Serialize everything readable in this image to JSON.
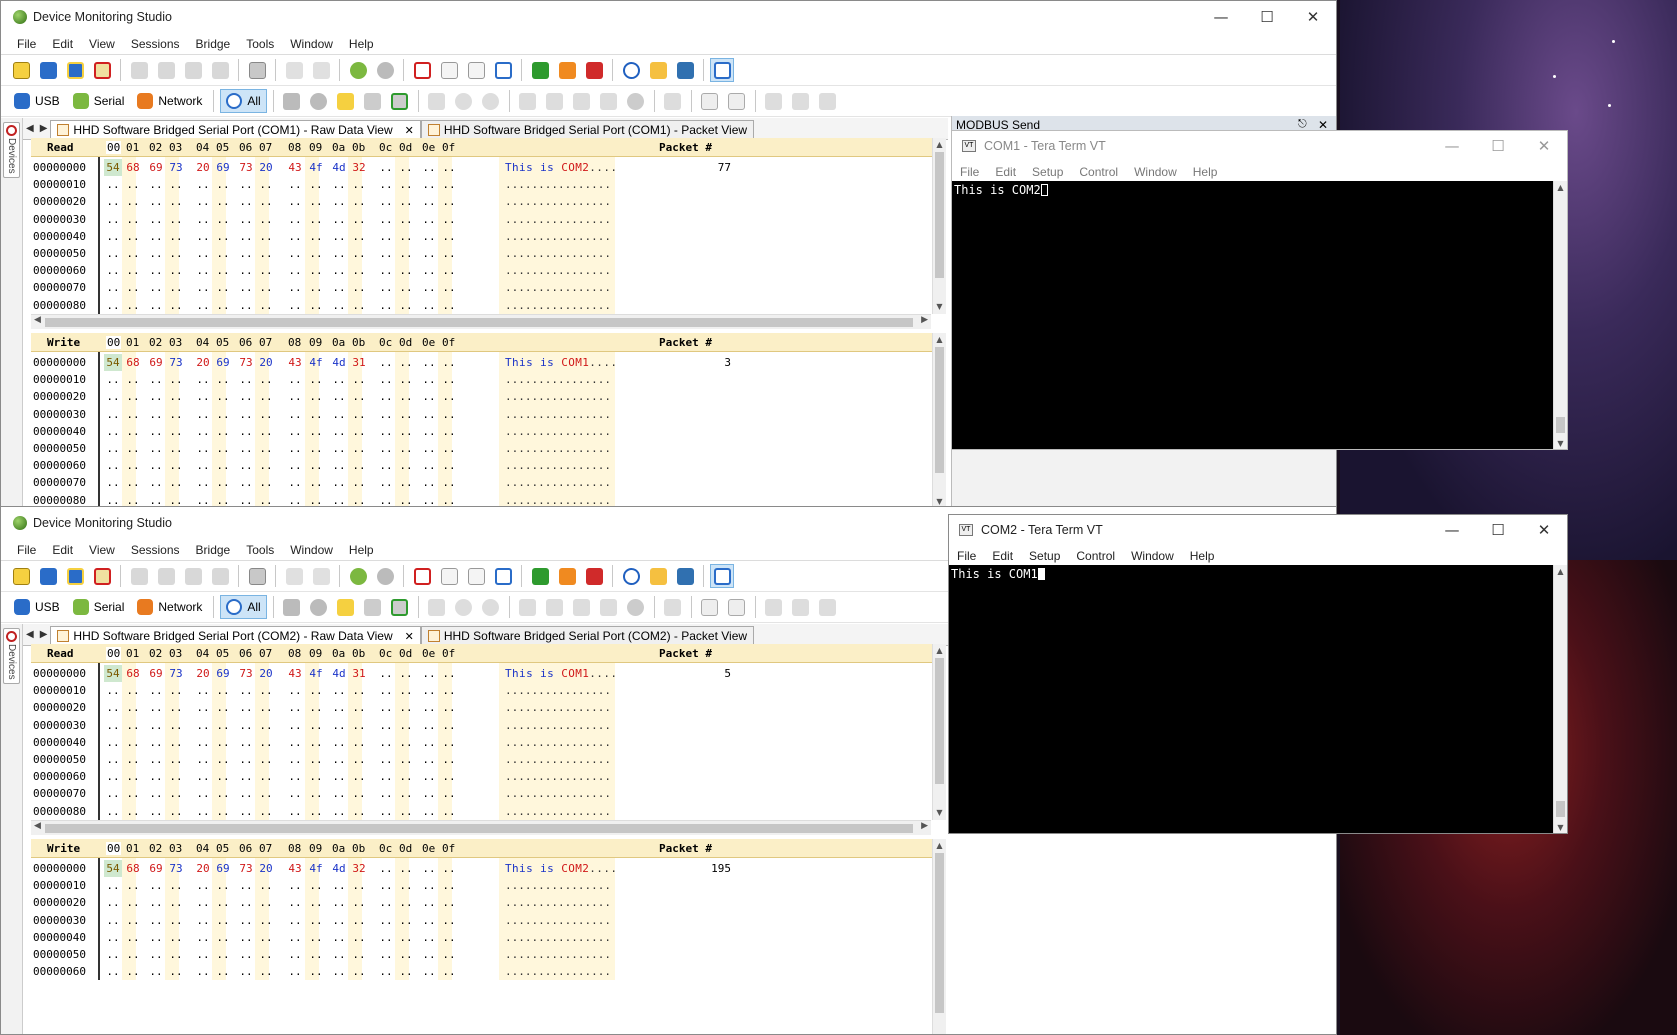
{
  "colors": {
    "accent": "#1a33c8",
    "hex_red": "#d01818",
    "header_bg": "#fbefc7",
    "selected_byte": "#cfe8cf"
  },
  "dms": {
    "title": "Device Monitoring Studio",
    "menu": [
      "File",
      "Edit",
      "View",
      "Sessions",
      "Bridge",
      "Tools",
      "Window",
      "Help"
    ],
    "filters": {
      "usb": "USB",
      "serial": "Serial",
      "network": "Network",
      "all": "All"
    },
    "devices_label": "Devices",
    "hex_columns": [
      "00",
      "01",
      "02",
      "03",
      "04",
      "05",
      "06",
      "07",
      "08",
      "09",
      "0a",
      "0b",
      "0c",
      "0d",
      "0e",
      "0f"
    ],
    "packet_header": "Packet #",
    "read_label": "Read",
    "write_label": "Write",
    "offsets": [
      "00000000",
      "00000010",
      "00000020",
      "00000030",
      "00000040",
      "00000050",
      "00000060",
      "00000070",
      "00000080"
    ],
    "offsets_short": [
      "00000000",
      "00000010",
      "00000020",
      "00000030",
      "00000040",
      "00000050",
      "00000060"
    ]
  },
  "top": {
    "tab_raw": "HHD Software Bridged Serial Port (COM1) - Raw Data View",
    "tab_packet": "HHD Software Bridged Serial Port (COM1) - Packet View",
    "read": {
      "bytes": [
        "54",
        "68",
        "69",
        "73",
        "20",
        "69",
        "73",
        "20",
        "43",
        "4f",
        "4d",
        "32"
      ],
      "ascii": "This is COM2....",
      "packet": "77"
    },
    "write": {
      "bytes": [
        "54",
        "68",
        "69",
        "73",
        "20",
        "69",
        "73",
        "20",
        "43",
        "4f",
        "4d",
        "31"
      ],
      "ascii": "This is COM1....",
      "packet": "3"
    }
  },
  "bottom": {
    "tab_raw": "HHD Software Bridged Serial Port (COM2) - Raw Data View",
    "tab_packet": "HHD Software Bridged Serial Port (COM2) - Packet View",
    "read": {
      "bytes": [
        "54",
        "68",
        "69",
        "73",
        "20",
        "69",
        "73",
        "20",
        "43",
        "4f",
        "4d",
        "31"
      ],
      "ascii": "This is COM1....",
      "packet": "5"
    },
    "write": {
      "bytes": [
        "54",
        "68",
        "69",
        "73",
        "20",
        "69",
        "73",
        "20",
        "43",
        "4f",
        "4d",
        "32"
      ],
      "ascii": "This is COM2....",
      "packet": "195"
    }
  },
  "modbus": {
    "title": "MODBUS Send"
  },
  "teraterm": {
    "menu": [
      "File",
      "Edit",
      "Setup",
      "Control",
      "Window",
      "Help"
    ],
    "com1": {
      "title": "COM1 - Tera Term VT",
      "text": "This is COM2"
    },
    "com2": {
      "title": "COM2 - Tera Term VT",
      "text": "This is COM1"
    }
  }
}
